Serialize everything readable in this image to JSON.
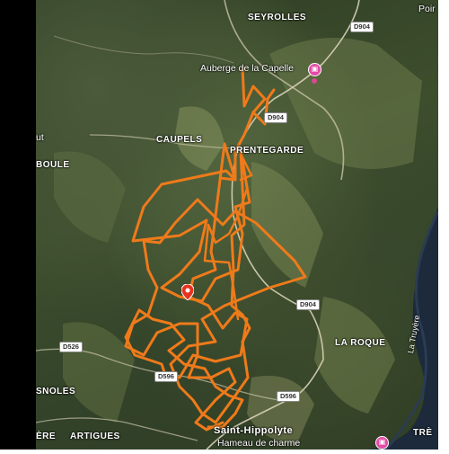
{
  "labels": {
    "seyrolles": "SEYROLLES",
    "auberge": "Auberge de la Capelle",
    "caupels": "CAUPELS",
    "prentegarde": "PRENTEGARDE",
    "boule": "BOULE",
    "ut": "ut",
    "laroque": "LA ROQUE",
    "latruyere": "La Truyère",
    "snoles": "SNOLES",
    "artigues": "ARTIGUES",
    "ere": "ÈRE",
    "sainthippolyte": "Saint-Hippolyte",
    "hameau": "Hameau de charme",
    "poir": "Poir",
    "tre": "TRÈ"
  },
  "roads": {
    "d904_a": "D904",
    "d904_b": "D904",
    "d904_c": "D904",
    "d526": "D526",
    "d596_a": "D596",
    "d596_b": "D596"
  },
  "icons": {
    "hotel_top": "hotel-icon",
    "hotel_bottom": "hotel-icon",
    "location_marker": "map-pin-icon"
  },
  "colors": {
    "track": "#ef7a1a",
    "poi": "#e24ca6",
    "river": "#1c2a3c"
  }
}
